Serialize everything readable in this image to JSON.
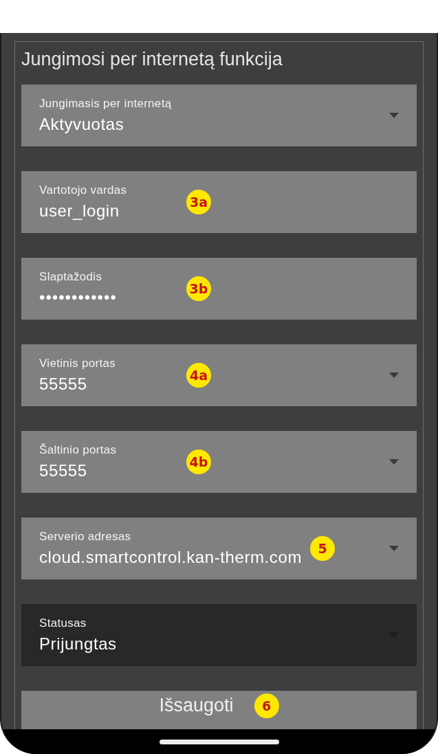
{
  "panel": {
    "title": "Jungimosi per internetą funkcija"
  },
  "fields": [
    {
      "kind": "select",
      "label": "Jungimasis per internetą",
      "value": "Aktyvuotas",
      "disabled": false
    },
    {
      "kind": "text",
      "label": "Vartotojo vardas",
      "value": "user_login",
      "disabled": false,
      "badge": "3a"
    },
    {
      "kind": "password",
      "label": "Slaptažodis",
      "value": "••••••••••••",
      "disabled": false,
      "badge": "3b"
    },
    {
      "kind": "select",
      "label": "Vietinis portas",
      "value": "55555",
      "disabled": false,
      "badge": "4a"
    },
    {
      "kind": "select",
      "label": "Šaltinio portas",
      "value": "55555",
      "disabled": false,
      "badge": "4b"
    },
    {
      "kind": "select",
      "label": "Serverio adresas",
      "value": "cloud.smartcontrol.kan-therm.com",
      "disabled": false,
      "badge": "5"
    },
    {
      "kind": "select",
      "label": "Statusas",
      "value": "Prijungtas",
      "disabled": true
    }
  ],
  "save_button": {
    "label": "Išsaugoti",
    "badge": "6"
  }
}
